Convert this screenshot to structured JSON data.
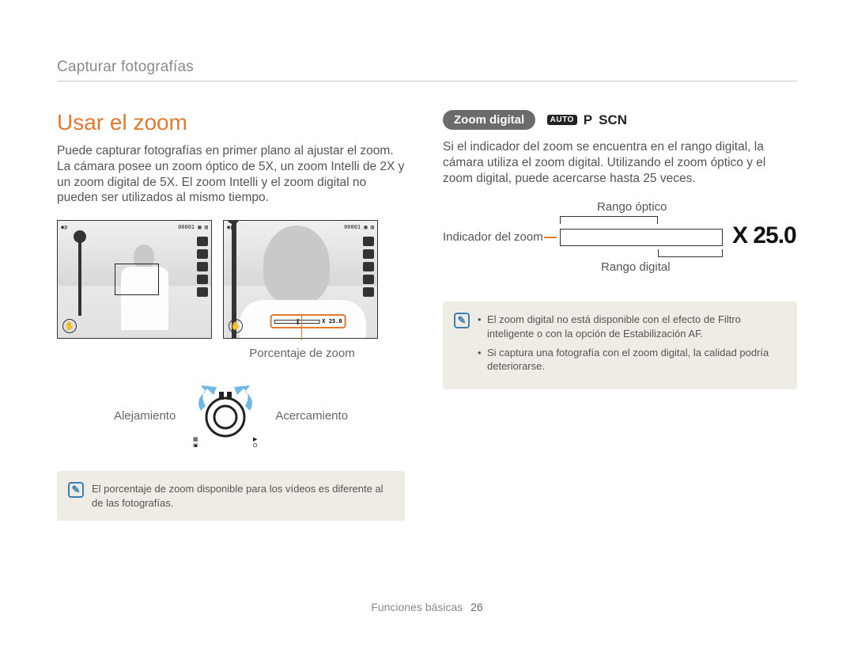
{
  "breadcrumb": "Capturar fotografías",
  "heading": "Usar el zoom",
  "intro": "Puede capturar fotografías en primer plano al ajustar el zoom. La cámara posee un zoom óptico de 5X, un zoom Intelli de 2X y un zoom digital de 5X. El zoom Intelli y el zoom digital no pueden ser utilizados al mismo tiempo.",
  "shot_counter": "00001",
  "zoom_sample": "X 25.0",
  "porcentaje_label": "Porcentaje de zoom",
  "alejamiento": "Alejamiento",
  "acercamiento": "Acercamiento",
  "note_left": "El porcentaje de zoom disponible para los vídeos es diferente al de las fotografías.",
  "pill_label": "Zoom digital",
  "mode_auto": "AUTO",
  "mode_p": "P",
  "mode_scn": "SCN",
  "right_body": "Si el indicador del zoom se encuentra en el rango digital, la cámara utiliza el zoom digital. Utilizando el zoom óptico y el zoom digital, puede acercarse hasta 25 veces.",
  "diag_optico": "Rango óptico",
  "diag_indicador": "Indicador del zoom",
  "diag_digital": "Rango digital",
  "diag_x": "X 25.0",
  "note_right_1": "El zoom digital no está disponible con el efecto de Filtro inteligente o con la opción de Estabilización AF.",
  "note_right_2": "Si captura una fotografía con el zoom digital, la calidad podría deteriorarse.",
  "footer_section": "Funciones básicas",
  "footer_page": "26"
}
